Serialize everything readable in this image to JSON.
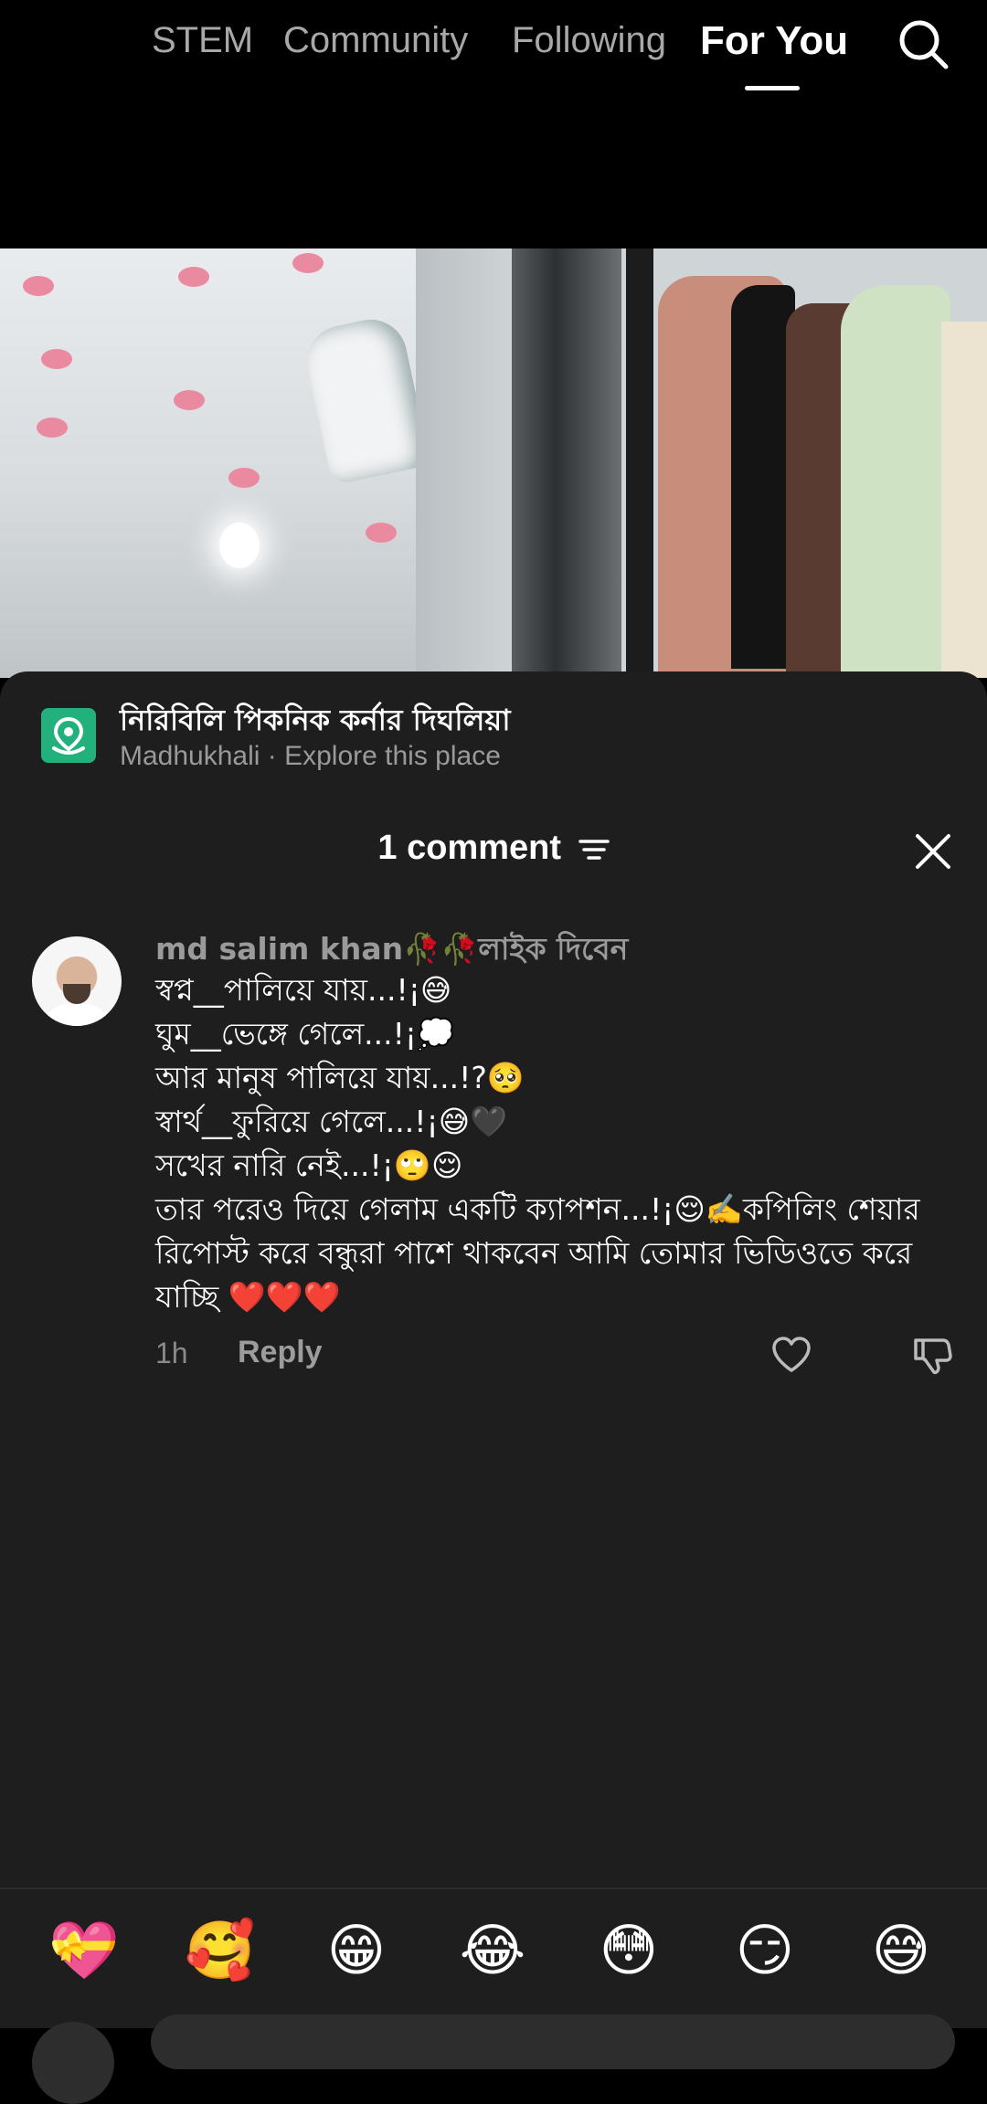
{
  "nav": {
    "tabs": [
      {
        "label": "STEM"
      },
      {
        "label": "Community"
      },
      {
        "label": "Following"
      },
      {
        "label": "For You"
      }
    ],
    "active_tab": "For You",
    "search_icon": "search-icon"
  },
  "place": {
    "title": "নিরিবিলি পিকনিক কর্নার দিঘলিয়া",
    "subtitle": "Madhukhali · Explore this place",
    "icon": "map-pin-icon",
    "icon_color": "#22b07d"
  },
  "comments_header": {
    "title": "1 comment",
    "filter_icon": "filter-icon",
    "close_icon": "close-icon"
  },
  "comments": [
    {
      "username": "md salim khan🥀🥀লাইক দিবেন",
      "lines": [
        "স্বপ্ন__পালিয়ে যায়...!¡😅",
        "ঘুম__ভেঙ্গে গেলে...!¡💭",
        "আর মানুষ পালিয়ে যায়...!?🥺",
        "স্বার্থ__ফুরিয়ে গেলে...!¡😅🖤",
        "সখের নারি নেই...!¡🙄😌",
        "তার পরেও দিয়ে গেলাম একটি ক্যাপশন...!¡😌✍️কপিলিং শেয়ার রিপোস্ট করে বন্ধুরা পাশে থাকবেন আমি তোমার ভিডিওতে করে যাচ্ছি ❤️❤️❤️"
      ],
      "time": "1h",
      "reply_label": "Reply"
    }
  ],
  "quick_emojis": [
    "💝",
    "🥰",
    "😁",
    "😂",
    "😳",
    "😏",
    "😅"
  ]
}
